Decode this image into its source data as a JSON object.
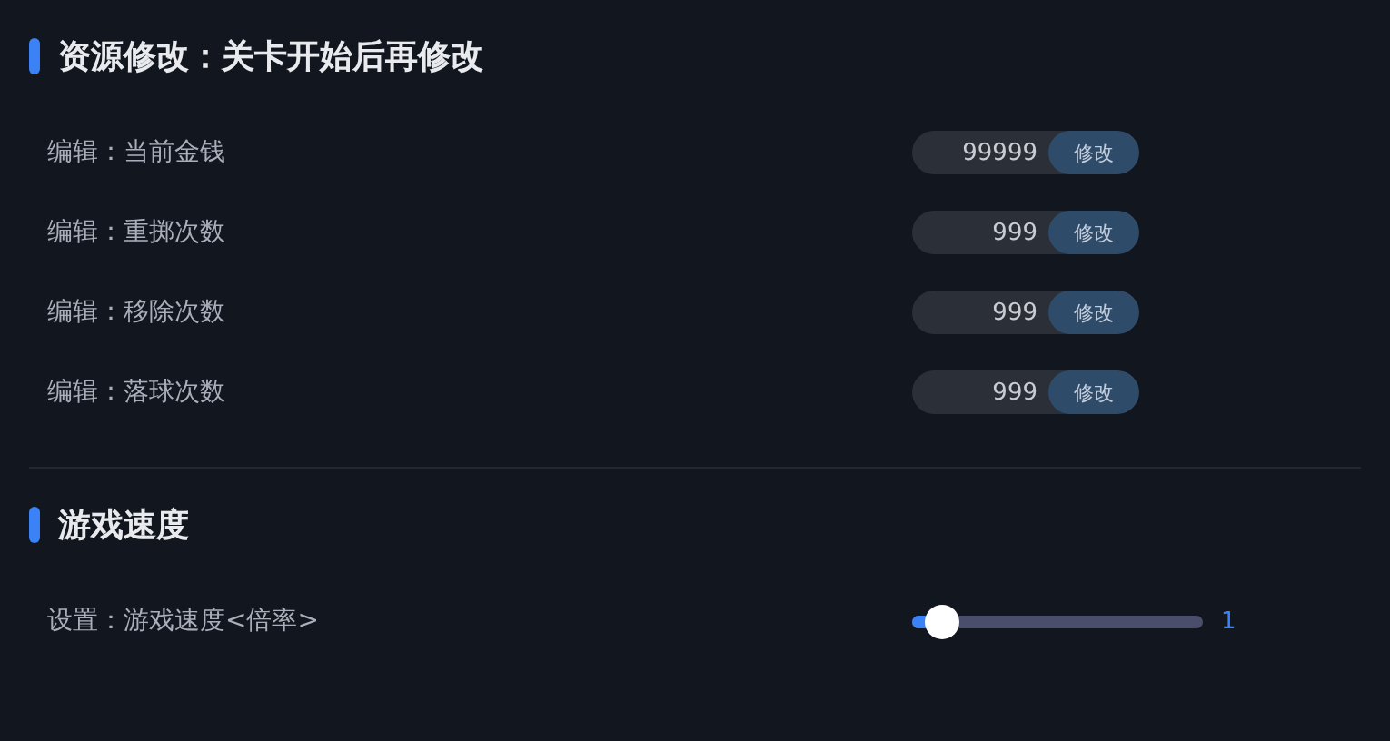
{
  "sections": [
    {
      "title": "资源修改：关卡开始后再修改",
      "rows": [
        {
          "kind": "edit",
          "label": "编辑：当前金钱",
          "value": "99999",
          "button": "修改"
        },
        {
          "kind": "edit",
          "label": "编辑：重掷次数",
          "value": "999",
          "button": "修改"
        },
        {
          "kind": "edit",
          "label": "编辑：移除次数",
          "value": "999",
          "button": "修改"
        },
        {
          "kind": "edit",
          "label": "编辑：落球次数",
          "value": "999",
          "button": "修改"
        }
      ]
    },
    {
      "title": "游戏速度",
      "rows": [
        {
          "kind": "slider",
          "label": "设置：游戏速度<倍率>",
          "level": 0.1,
          "reading": "1"
        }
      ]
    }
  ]
}
